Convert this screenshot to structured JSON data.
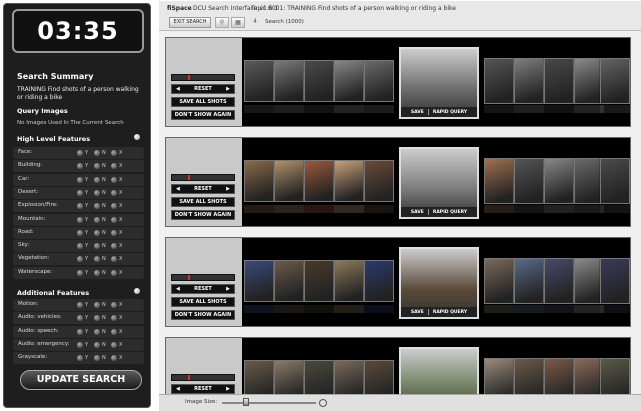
{
  "sidebar": {
    "timer": "03:35",
    "title": "Search Summary",
    "topic_text": "TRAINING Find shots of a person walking or riding a bike",
    "query_images_heading": "Query Images",
    "query_images_note": "No Images Used In The Current Search",
    "high_level_heading": "High Level Features",
    "additional_heading": "Additional Features",
    "option_labels": [
      "Y",
      "N",
      "X"
    ],
    "high_level_features": [
      {
        "label": "Face:"
      },
      {
        "label": "Building:"
      },
      {
        "label": "Car:"
      },
      {
        "label": "Desert:"
      },
      {
        "label": "Explosion/Fire:"
      },
      {
        "label": "Mountain:"
      },
      {
        "label": "Road:"
      },
      {
        "label": "Sky:"
      },
      {
        "label": "Vegetation:"
      },
      {
        "label": "Waterscape:"
      }
    ],
    "additional_features": [
      {
        "label": "Motion:"
      },
      {
        "label": "Audio: vehicles:"
      },
      {
        "label": "Audio: speech:"
      },
      {
        "label": "Audio: emergency:"
      },
      {
        "label": "Grayscale:"
      }
    ],
    "update_button": "UPDATE SEARCH"
  },
  "topbar": {
    "brand": "fiSpace",
    "title": "DCU Search Interface v1.6.1",
    "topic": "Topic 0001: TRAINING Find shots of a person walking or riding a bike",
    "exit_button": "EXIT SEARCH",
    "page_number": "4",
    "search_label": "Search (1000)"
  },
  "row_controls": {
    "reset": "RESET",
    "save_all": "SAVE ALL SHOTS",
    "dont_show": "DON'T SHOW AGAIN",
    "save": "SAVE",
    "rapid_query": "RAPID QUERY"
  },
  "rows": [
    {
      "center_color": "#6b6b6b",
      "thumb_colors": [
        "#5a5a5a",
        "#7a7a7a",
        "#4a4a4a",
        "#888",
        "#6a6a6a",
        "#555",
        "#7e7e7e",
        "#494949",
        "#8a8a8a",
        "#646464",
        "#5c5c5c",
        "#777",
        "#505050"
      ]
    },
    {
      "center_color": "#7a7a7a",
      "thumb_colors": [
        "#8a6a4a",
        "#b0906a",
        "#9a5a3a",
        "#c9a07a",
        "#6a4a3a",
        "#a07050",
        "#555",
        "#888",
        "#6a6a6a",
        "#4a4a4a",
        "#7a7a7a",
        "#5a5a5a",
        "#999"
      ]
    },
    {
      "center_color": "#5a4a3a",
      "thumb_colors": [
        "#3a4a7a",
        "#6a5a4a",
        "#4a3a2a",
        "#8a7a5a",
        "#2a3a6a",
        "#7a6a5a",
        "#5a6a8a",
        "#4a4a6a",
        "#8a8a8a",
        "#3a3a5a",
        "#6a7a9a",
        "#4a5a7a",
        "#9a9aaa"
      ]
    },
    {
      "center_color": "#6a7a5a",
      "thumb_colors": [
        "#6a5a4a",
        "#8a7a6a",
        "#4a4a3a",
        "#7a6a5a",
        "#5a4a3a",
        "#9a8a7a",
        "#6a5a4a",
        "#7a5a4a",
        "#8a6a5a",
        "#5a5a4a",
        "#9a7a6a",
        "#6a6a5a",
        "#7a7a6a"
      ]
    }
  ],
  "bottombar": {
    "image_size_label": "Image Size:"
  }
}
